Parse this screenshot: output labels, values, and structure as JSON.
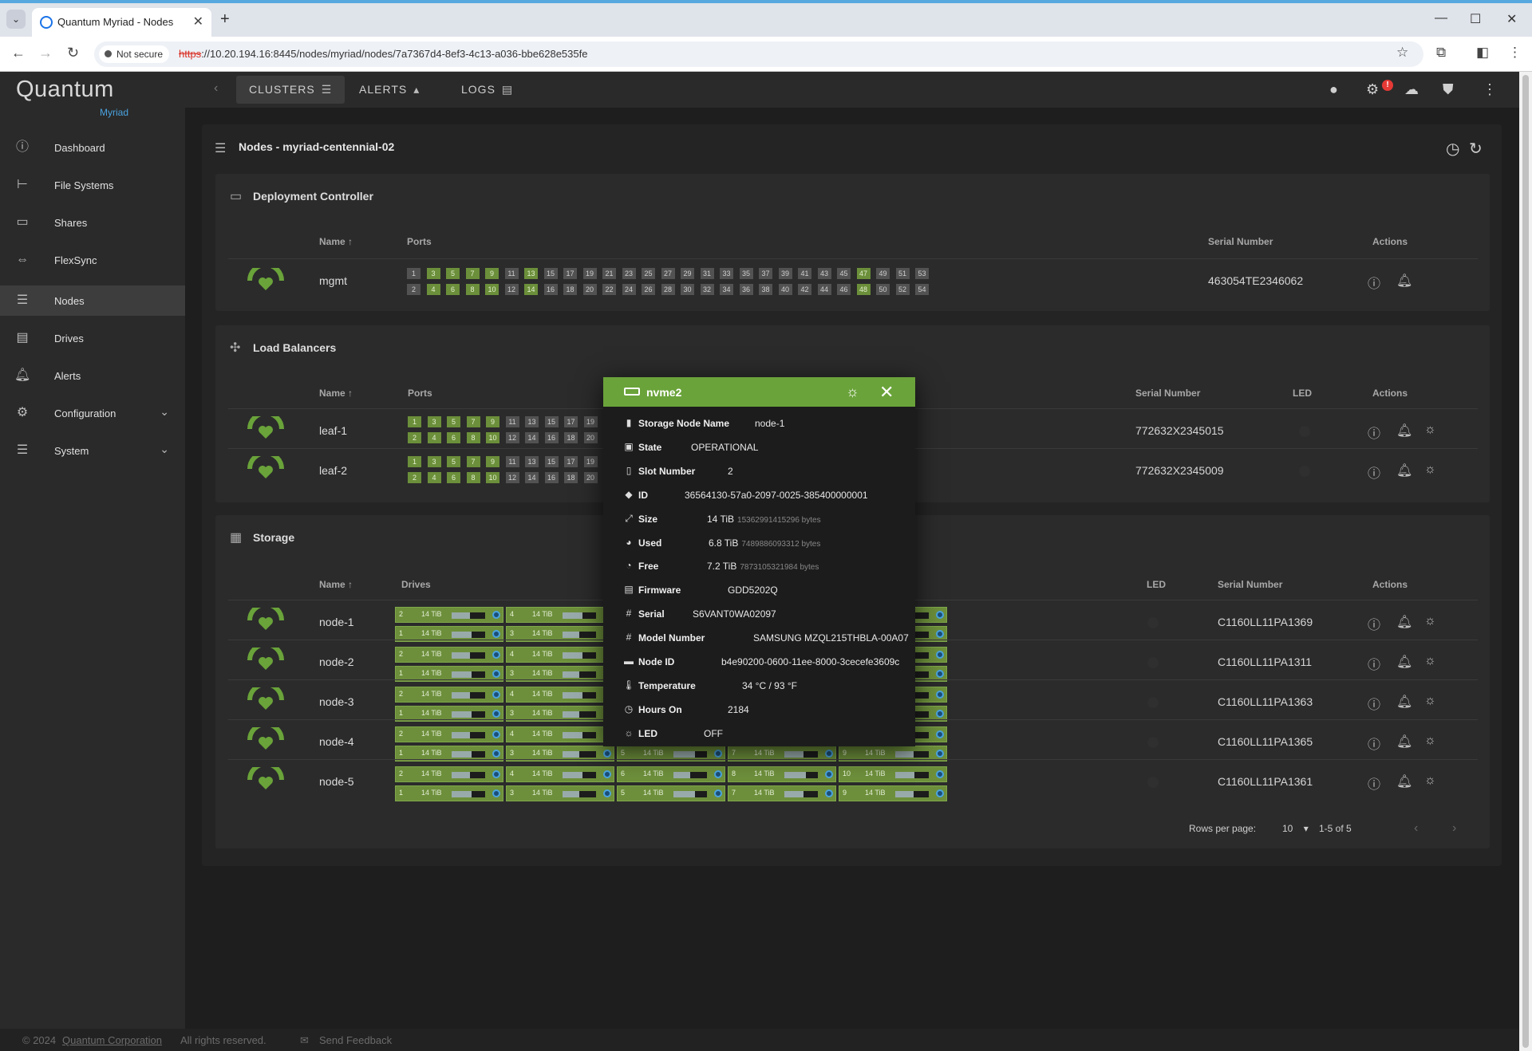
{
  "browser": {
    "tab_title": "Quantum Myriad - Nodes",
    "security_label": "Not secure",
    "url_scheme": "https",
    "url_rest": "://10.20.194.16:8445/nodes/myriad/nodes/7a7367d4-8ef3-4c13-a036-bbe628e535fe"
  },
  "app": {
    "logo": "Quantum",
    "logo_sub": "Myriad"
  },
  "sidebar": {
    "items": [
      {
        "label": "Dashboard",
        "icon": "info-icon"
      },
      {
        "label": "File Systems",
        "icon": "tree-icon"
      },
      {
        "label": "Shares",
        "icon": "monitor-icon"
      },
      {
        "label": "FlexSync",
        "icon": "arrows-icon"
      },
      {
        "label": "Nodes",
        "icon": "server-icon",
        "active": true
      },
      {
        "label": "Drives",
        "icon": "drive-icon"
      },
      {
        "label": "Alerts",
        "icon": "bell-icon"
      },
      {
        "label": "Configuration",
        "icon": "gear-icon",
        "expandable": true
      },
      {
        "label": "System",
        "icon": "server-icon",
        "expandable": true
      }
    ]
  },
  "topnav": {
    "tabs": [
      {
        "label": "CLUSTERS",
        "active": true
      },
      {
        "label": "ALERTS"
      },
      {
        "label": "LOGS"
      }
    ],
    "alert_badge": "!"
  },
  "page": {
    "title": "Nodes - myriad-centennial-02"
  },
  "deployment": {
    "title": "Deployment Controller",
    "columns": {
      "name": "Name",
      "ports": "Ports",
      "serial": "Serial Number",
      "actions": "Actions"
    },
    "rows": [
      {
        "name": "mgmt",
        "serial": "463054TE2346062",
        "ports_top": [
          {
            "n": "1",
            "up": false
          },
          {
            "n": "3",
            "up": true
          },
          {
            "n": "5",
            "up": true
          },
          {
            "n": "7",
            "up": true
          },
          {
            "n": "9",
            "up": true
          },
          {
            "n": "11",
            "up": false
          },
          {
            "n": "13",
            "up": true
          },
          {
            "n": "15",
            "up": false
          },
          {
            "n": "17",
            "up": false
          },
          {
            "n": "19",
            "up": false
          },
          {
            "n": "21",
            "up": false
          },
          {
            "n": "23",
            "up": false
          },
          {
            "n": "25",
            "up": false
          },
          {
            "n": "27",
            "up": false
          },
          {
            "n": "29",
            "up": false
          },
          {
            "n": "31",
            "up": false
          },
          {
            "n": "33",
            "up": false
          },
          {
            "n": "35",
            "up": false
          },
          {
            "n": "37",
            "up": false
          },
          {
            "n": "39",
            "up": false
          },
          {
            "n": "41",
            "up": false
          },
          {
            "n": "43",
            "up": false
          },
          {
            "n": "45",
            "up": false
          },
          {
            "n": "47",
            "up": true
          },
          {
            "n": "49",
            "up": false
          },
          {
            "n": "51",
            "up": false
          },
          {
            "n": "53",
            "up": false
          }
        ],
        "ports_bottom": [
          {
            "n": "2",
            "up": false
          },
          {
            "n": "4",
            "up": true
          },
          {
            "n": "6",
            "up": true
          },
          {
            "n": "8",
            "up": true
          },
          {
            "n": "10",
            "up": true
          },
          {
            "n": "12",
            "up": false
          },
          {
            "n": "14",
            "up": true
          },
          {
            "n": "16",
            "up": false
          },
          {
            "n": "18",
            "up": false
          },
          {
            "n": "20",
            "up": false
          },
          {
            "n": "22",
            "up": false
          },
          {
            "n": "24",
            "up": false
          },
          {
            "n": "26",
            "up": false
          },
          {
            "n": "28",
            "up": false
          },
          {
            "n": "30",
            "up": false
          },
          {
            "n": "32",
            "up": false
          },
          {
            "n": "34",
            "up": false
          },
          {
            "n": "36",
            "up": false
          },
          {
            "n": "38",
            "up": false
          },
          {
            "n": "40",
            "up": false
          },
          {
            "n": "42",
            "up": false
          },
          {
            "n": "44",
            "up": false
          },
          {
            "n": "46",
            "up": false
          },
          {
            "n": "48",
            "up": true
          },
          {
            "n": "50",
            "up": false
          },
          {
            "n": "52",
            "up": false
          },
          {
            "n": "54",
            "up": false
          }
        ]
      }
    ]
  },
  "load_balancers": {
    "title": "Load Balancers",
    "columns": {
      "name": "Name",
      "ports": "Ports",
      "serial": "Serial Number",
      "led": "LED",
      "actions": "Actions"
    },
    "rows": [
      {
        "name": "leaf-1",
        "serial": "772632X2345015",
        "ports_top": [
          {
            "n": "1",
            "up": true
          },
          {
            "n": "3",
            "up": true
          },
          {
            "n": "5",
            "up": true
          },
          {
            "n": "7",
            "up": true
          },
          {
            "n": "9",
            "up": true
          },
          {
            "n": "11",
            "up": false
          },
          {
            "n": "13",
            "up": false
          },
          {
            "n": "15",
            "up": false
          },
          {
            "n": "17",
            "up": false
          },
          {
            "n": "19",
            "up": false
          }
        ],
        "ports_bottom": [
          {
            "n": "2",
            "up": true
          },
          {
            "n": "4",
            "up": true
          },
          {
            "n": "6",
            "up": true
          },
          {
            "n": "8",
            "up": true
          },
          {
            "n": "10",
            "up": true
          },
          {
            "n": "12",
            "up": false
          },
          {
            "n": "14",
            "up": false
          },
          {
            "n": "16",
            "up": false
          },
          {
            "n": "18",
            "up": false
          },
          {
            "n": "20",
            "up": false
          }
        ]
      },
      {
        "name": "leaf-2",
        "serial": "772632X2345009",
        "ports_top": [
          {
            "n": "1",
            "up": true
          },
          {
            "n": "3",
            "up": true
          },
          {
            "n": "5",
            "up": true
          },
          {
            "n": "7",
            "up": true
          },
          {
            "n": "9",
            "up": true
          },
          {
            "n": "11",
            "up": false
          },
          {
            "n": "13",
            "up": false
          },
          {
            "n": "15",
            "up": false
          },
          {
            "n": "17",
            "up": false
          },
          {
            "n": "19",
            "up": false
          }
        ],
        "ports_bottom": [
          {
            "n": "2",
            "up": true
          },
          {
            "n": "4",
            "up": true
          },
          {
            "n": "6",
            "up": true
          },
          {
            "n": "8",
            "up": true
          },
          {
            "n": "10",
            "up": true
          },
          {
            "n": "12",
            "up": false
          },
          {
            "n": "14",
            "up": false
          },
          {
            "n": "16",
            "up": false
          },
          {
            "n": "18",
            "up": false
          },
          {
            "n": "20",
            "up": false
          }
        ]
      }
    ]
  },
  "storage": {
    "title": "Storage",
    "columns": {
      "name": "Name",
      "drives": "Drives",
      "led": "LED",
      "serial": "Serial Number",
      "actions": "Actions"
    },
    "drive_size_label": "14 TiB",
    "rows": [
      {
        "name": "node-1",
        "serial": "C1160LL11PA1369",
        "drives_top": [
          "2",
          "4",
          "",
          "",
          ""
        ],
        "drives_bottom": [
          "1",
          "3",
          "",
          "",
          ""
        ]
      },
      {
        "name": "node-2",
        "serial": "C1160LL11PA1311",
        "drives_top": [
          "2",
          "4",
          "",
          "",
          ""
        ],
        "drives_bottom": [
          "1",
          "3",
          "",
          "",
          ""
        ]
      },
      {
        "name": "node-3",
        "serial": "C1160LL11PA1363",
        "drives_top": [
          "2",
          "4",
          "",
          "",
          ""
        ],
        "drives_bottom": [
          "1",
          "3",
          "",
          "",
          ""
        ]
      },
      {
        "name": "node-4",
        "serial": "C1160LL11PA1365",
        "drives_top": [
          "2",
          "4",
          "",
          "",
          ""
        ],
        "drives_bottom": [
          "1",
          "3",
          "5",
          "7",
          "9"
        ]
      },
      {
        "name": "node-5",
        "serial": "C1160LL11PA1361",
        "drives_top": [
          "2",
          "4",
          "6",
          "8",
          "10"
        ],
        "drives_bottom": [
          "1",
          "3",
          "5",
          "7",
          "9"
        ]
      }
    ],
    "pagination": {
      "rows_per_page_label": "Rows per page:",
      "rows_per_page": "10",
      "range": "1-5 of 5"
    }
  },
  "popup": {
    "title": "nvme2",
    "fields": [
      {
        "key": "Storage Node Name",
        "value": "node-1",
        "icon": "node-icon"
      },
      {
        "key": "State",
        "value": "OPERATIONAL",
        "icon": "state-icon"
      },
      {
        "key": "Slot Number",
        "value": "2",
        "icon": "slot-icon"
      },
      {
        "key": "ID",
        "value": "36564130-57a0-2097-0025-385400000001",
        "icon": "tag-icon"
      },
      {
        "key": "Size",
        "value": "14 TiB",
        "sub": "15362991415296 bytes",
        "icon": "expand-icon"
      },
      {
        "key": "Used",
        "value": "6.8 TiB",
        "sub": "7489886093312 bytes",
        "icon": "pie-icon"
      },
      {
        "key": "Free",
        "value": "7.2 TiB",
        "sub": "7873105321984 bytes",
        "icon": "circle-icon"
      },
      {
        "key": "Firmware",
        "value": "GDD5202Q",
        "icon": "firmware-icon"
      },
      {
        "key": "Serial",
        "value": "S6VANT0WA02097",
        "icon": "hash-icon"
      },
      {
        "key": "Model Number",
        "value": "SAMSUNG MZQL215THBLA-00A07",
        "icon": "hash-icon"
      },
      {
        "key": "Node ID",
        "value": "b4e90200-0600-11ee-8000-3cecefe3609c",
        "icon": "id-icon"
      },
      {
        "key": "Temperature",
        "value": "34 °C / 93 °F",
        "icon": "thermometer-icon"
      },
      {
        "key": "Hours On",
        "value": "2184",
        "icon": "clock-icon"
      },
      {
        "key": "LED",
        "value": "OFF",
        "icon": "siren-icon"
      }
    ]
  },
  "footer": {
    "copyright": "© 2024",
    "company": "Quantum Corporation",
    "rights": "All rights reserved.",
    "feedback": "Send Feedback"
  },
  "colors": {
    "accent_green": "#6aa33a",
    "port_up": "#6b8f3a",
    "link_blue": "#4aa3df"
  }
}
